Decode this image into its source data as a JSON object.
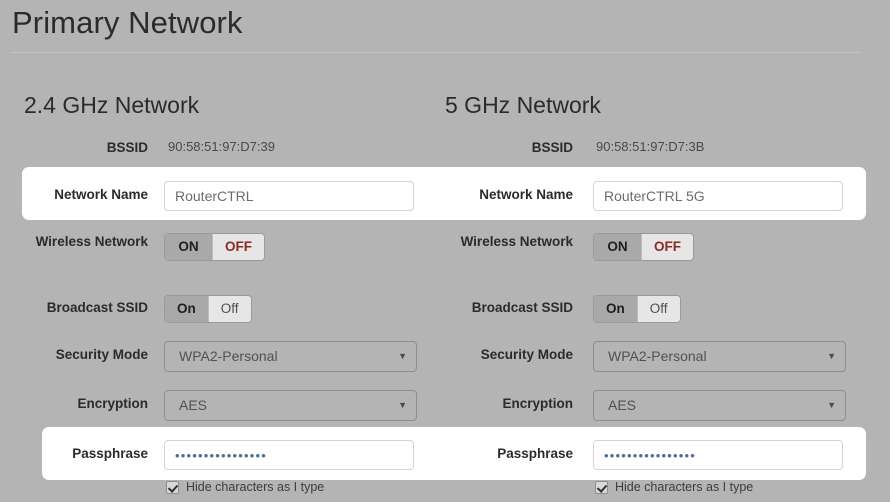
{
  "page": {
    "title": "Primary Network"
  },
  "networks": [
    {
      "heading": "2.4 GHz Network",
      "bssid_label": "BSSID",
      "bssid_value": "90:58:51:97:D7:39",
      "network_name_label": "Network Name",
      "network_name_value": "RouterCTRL",
      "wireless_label": "Wireless Network",
      "wireless_on": "ON",
      "wireless_off": "OFF",
      "wireless_selected": "ON",
      "broadcast_label": "Broadcast SSID",
      "broadcast_on": "On",
      "broadcast_off": "Off",
      "broadcast_selected": "On",
      "security_label": "Security Mode",
      "security_value": "WPA2-Personal",
      "encryption_label": "Encryption",
      "encryption_value": "AES",
      "passphrase_label": "Passphrase",
      "passphrase_masked": "••••••••••••••••",
      "hide_characters_label": "Hide characters as I type",
      "hide_characters_checked": true
    },
    {
      "heading": "5 GHz Network",
      "bssid_label": "BSSID",
      "bssid_value": "90:58:51:97:D7:3B",
      "network_name_label": "Network Name",
      "network_name_value": "RouterCTRL 5G",
      "wireless_label": "Wireless Network",
      "wireless_on": "ON",
      "wireless_off": "OFF",
      "wireless_selected": "ON",
      "broadcast_label": "Broadcast SSID",
      "broadcast_on": "On",
      "broadcast_off": "Off",
      "broadcast_selected": "On",
      "security_label": "Security Mode",
      "security_value": "WPA2-Personal",
      "encryption_label": "Encryption",
      "encryption_value": "AES",
      "passphrase_label": "Passphrase",
      "passphrase_masked": "••••••••••••••••",
      "hide_characters_label": "Hide characters as I type",
      "hide_characters_checked": true
    }
  ],
  "icons": {
    "dropdown_caret": "▼"
  },
  "colors": {
    "page_background": "#b4b4b4",
    "band_background": "#ffffff",
    "toggle_selected": "#a9a9a9",
    "toggle_unselected": "#e6e6e6",
    "off_accent": "#8c2b22",
    "text_primary": "#2b2b2b",
    "input_text": "#6d6d6d"
  }
}
